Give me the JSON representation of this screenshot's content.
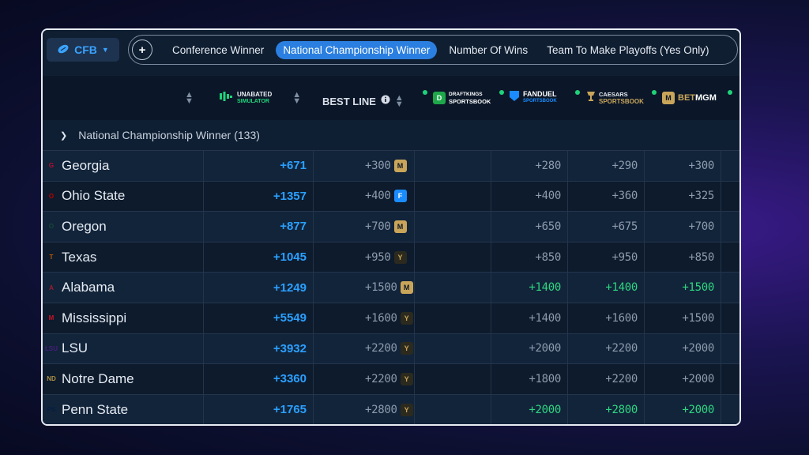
{
  "topbar": {
    "sport_label": "CFB",
    "plus_label": "+",
    "tabs": [
      {
        "label": "Conference Winner",
        "active": false
      },
      {
        "label": "National Championship Winner",
        "active": true
      },
      {
        "label": "Number Of Wins",
        "active": false
      },
      {
        "label": "Team To Make Playoffs (Yes Only)",
        "active": false
      }
    ]
  },
  "header": {
    "simulator_line1": "UNABATED",
    "simulator_line2": "SIMULATOR",
    "best_line": "BEST LINE",
    "books": [
      {
        "name": "DRAFTKINGS",
        "sub": "SPORTSBOOK",
        "icon": "draftkings-icon",
        "color": "#1ea84a"
      },
      {
        "name": "FANDUEL",
        "sub": "SPORTSBOOK",
        "icon": "fanduel-icon",
        "color": "#1a8cff"
      },
      {
        "name": "CAESARS",
        "sub": "SPORTSBOOK",
        "icon": "caesars-icon",
        "color": "#c9a55a"
      },
      {
        "name": "BET",
        "sub": "MGM",
        "icon": "betmgm-icon",
        "color": "#c9a55a"
      }
    ]
  },
  "group": {
    "label": "National Championship Winner",
    "count": "(133)"
  },
  "rows": [
    {
      "team": "Georgia",
      "logo": "G",
      "logo_color": "#ba0c2f",
      "sim": "+671",
      "best": "+300",
      "best_book": "betmgm-icon",
      "odds": [
        "+280",
        "+290",
        "+300"
      ],
      "green": false
    },
    {
      "team": "Ohio State",
      "logo": "O",
      "logo_color": "#bb0000",
      "sim": "+1357",
      "best": "+400",
      "best_book": "fanduel-icon",
      "odds": [
        "+400",
        "+360",
        "+325"
      ],
      "green": false
    },
    {
      "team": "Oregon",
      "logo": "O",
      "logo_color": "#154733",
      "sim": "+877",
      "best": "+700",
      "best_book": "betmgm-icon",
      "odds": [
        "+650",
        "+675",
        "+700"
      ],
      "green": false
    },
    {
      "team": "Texas",
      "logo": "T",
      "logo_color": "#bf5700",
      "sim": "+1045",
      "best": "+950",
      "best_book": "caesars-icon",
      "odds": [
        "+850",
        "+950",
        "+850"
      ],
      "green": false
    },
    {
      "team": "Alabama",
      "logo": "A",
      "logo_color": "#9e1b32",
      "sim": "+1249",
      "best": "+1500",
      "best_book": "betmgm-icon",
      "odds": [
        "+1400",
        "+1400",
        "+1500"
      ],
      "green": true
    },
    {
      "team": "Mississippi",
      "logo": "M",
      "logo_color": "#ce1126",
      "sim": "+5549",
      "best": "+1600",
      "best_book": "caesars-icon",
      "odds": [
        "+1400",
        "+1600",
        "+1500"
      ],
      "green": false
    },
    {
      "team": "LSU",
      "logo": "LSU",
      "logo_color": "#461d7c",
      "sim": "+3932",
      "best": "+2200",
      "best_book": "caesars-icon",
      "odds": [
        "+2000",
        "+2200",
        "+2000"
      ],
      "green": false
    },
    {
      "team": "Notre Dame",
      "logo": "ND",
      "logo_color": "#ae9142",
      "sim": "+3360",
      "best": "+2200",
      "best_book": "caesars-icon",
      "odds": [
        "+1800",
        "+2200",
        "+2000"
      ],
      "green": false
    },
    {
      "team": "Penn State",
      "logo": "PS",
      "logo_color": "#041e42",
      "sim": "+1765",
      "best": "+2800",
      "best_book": "caesars-icon",
      "odds": [
        "+2000",
        "+2800",
        "+2000"
      ],
      "green": true
    }
  ]
}
